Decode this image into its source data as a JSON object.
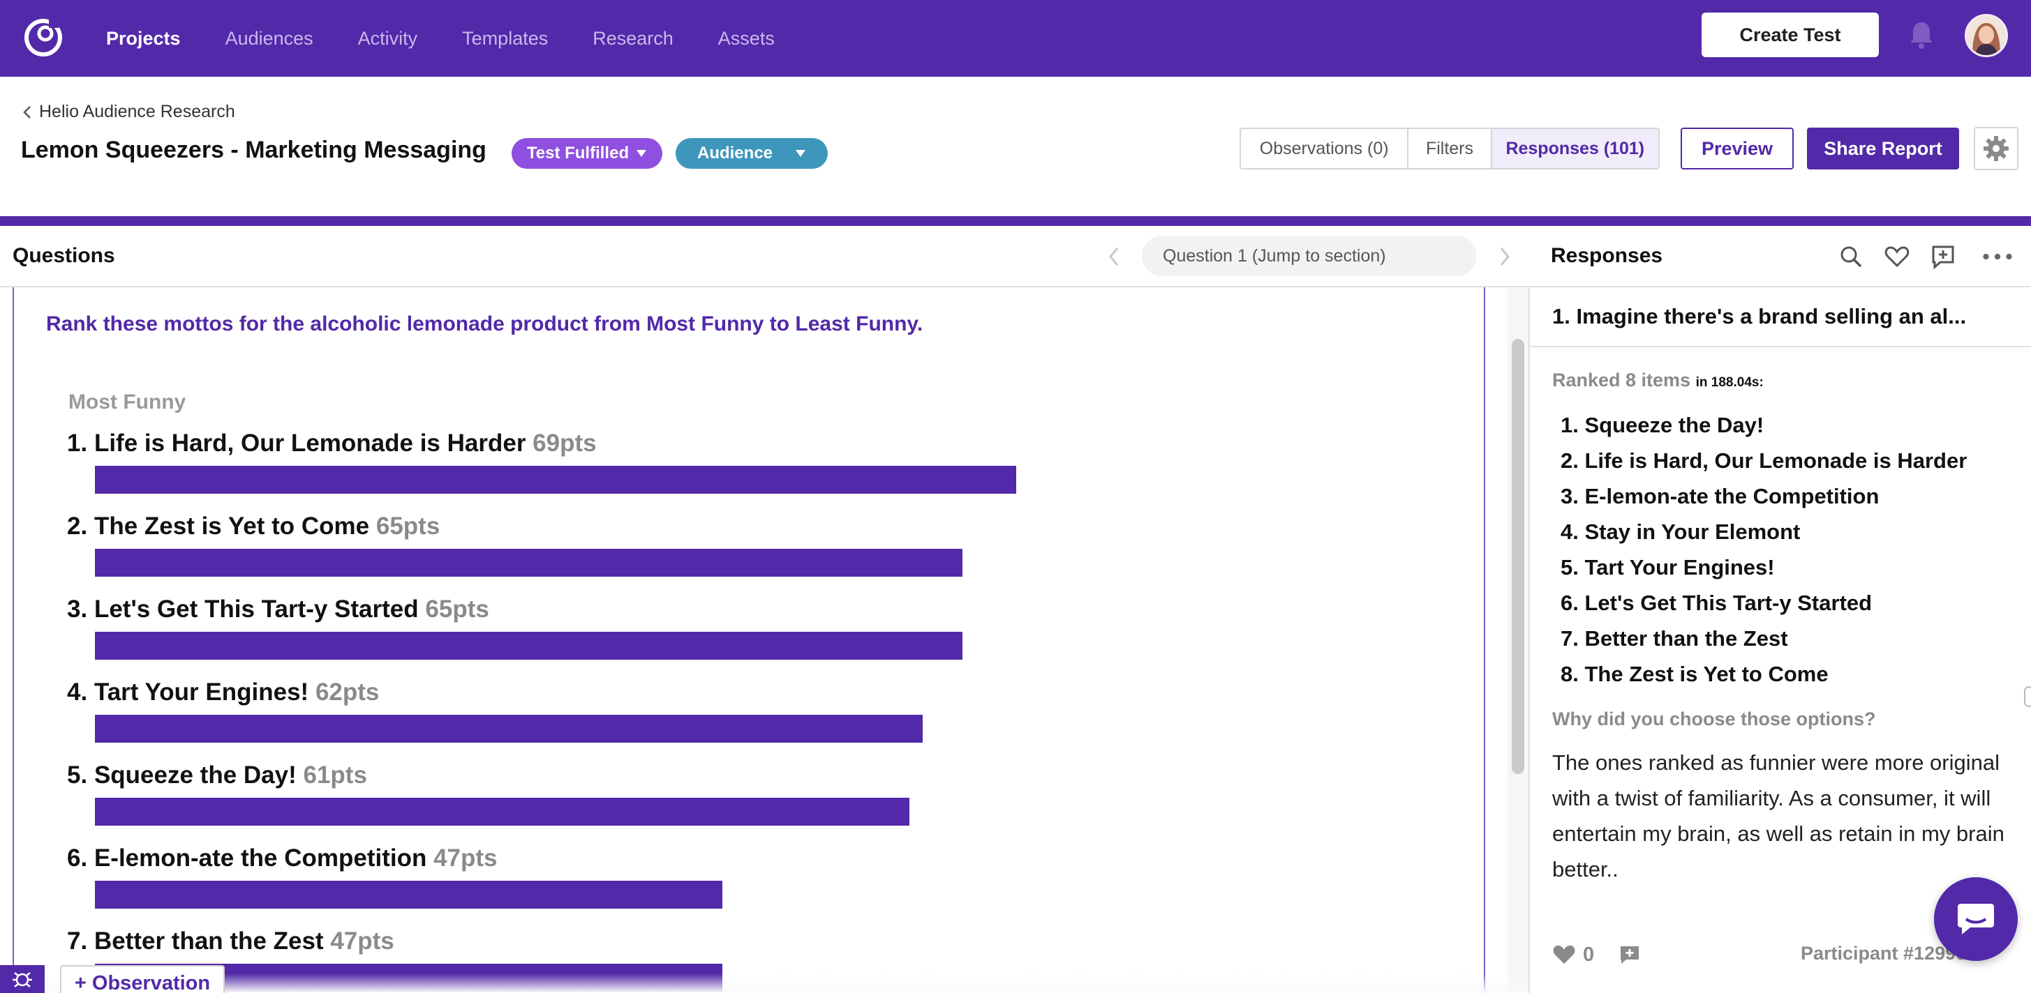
{
  "nav": {
    "items": [
      {
        "label": "Projects",
        "active": true
      },
      {
        "label": "Audiences",
        "active": false
      },
      {
        "label": "Activity",
        "active": false
      },
      {
        "label": "Templates",
        "active": false
      },
      {
        "label": "Research",
        "active": false
      },
      {
        "label": "Assets",
        "active": false
      }
    ],
    "create_label": "Create Test",
    "brand_color": "#5229a8"
  },
  "header": {
    "breadcrumb": "Helio Audience Research",
    "title": "Lemon Squeezers - Marketing Messaging",
    "status_pill": "Test Fulfilled",
    "audience_pill": "Audience",
    "tabs": [
      {
        "label": "Observations (0)",
        "active": false
      },
      {
        "label": "Filters",
        "active": false
      },
      {
        "label": "Responses (101)",
        "active": true
      }
    ],
    "preview_label": "Preview",
    "share_label": "Share Report"
  },
  "questions": {
    "title": "Questions",
    "jump_label": "Question 1 (Jump to section)",
    "question_text": "Rank these mottos for the alcoholic lemonade product from Most Funny to Least Funny.",
    "top_label": "Most Funny",
    "max_points": 69,
    "rankings": [
      {
        "rank": "1.",
        "label": "Life is Hard, Our Lemonade is Harder",
        "points": 69,
        "points_label": "69pts"
      },
      {
        "rank": "2.",
        "label": "The Zest is Yet to Come",
        "points": 65,
        "points_label": "65pts"
      },
      {
        "rank": "3.",
        "label": "Let's Get This Tart-y Started",
        "points": 65,
        "points_label": "65pts"
      },
      {
        "rank": "4.",
        "label": "Tart Your Engines!",
        "points": 62,
        "points_label": "62pts"
      },
      {
        "rank": "5.",
        "label": "Squeeze the Day!",
        "points": 61,
        "points_label": "61pts"
      },
      {
        "rank": "6.",
        "label": "E-lemon-ate the Competition",
        "points": 47,
        "points_label": "47pts"
      },
      {
        "rank": "7.",
        "label": "Better than the Zest",
        "points": 47,
        "points_label": "47pts"
      }
    ],
    "observation_label": "+ Observation"
  },
  "responses": {
    "title": "Responses",
    "question": "1. Imagine there's a brand selling an al...",
    "ranked_meta": "Ranked 8 items",
    "ranked_time": "in 188.04s:",
    "items": [
      "1. Squeeze the Day!",
      "2. Life is Hard, Our Lemonade is Harder",
      "3. E-lemon-ate the Competition",
      "4. Stay in Your Elemont",
      "5. Tart Your Engines!",
      "6. Let's Get This Tart-y Started",
      "7. Better than the Zest",
      "8. The Zest is Yet to Come"
    ],
    "why_label": "Why did you choose those options?",
    "answer": "The ones ranked as funnier were more original with a twist of familiarity. As a consumer, it will entertain my brain, as well as retain in my brain better..",
    "likes": "0",
    "participant": "Participant #12996"
  }
}
